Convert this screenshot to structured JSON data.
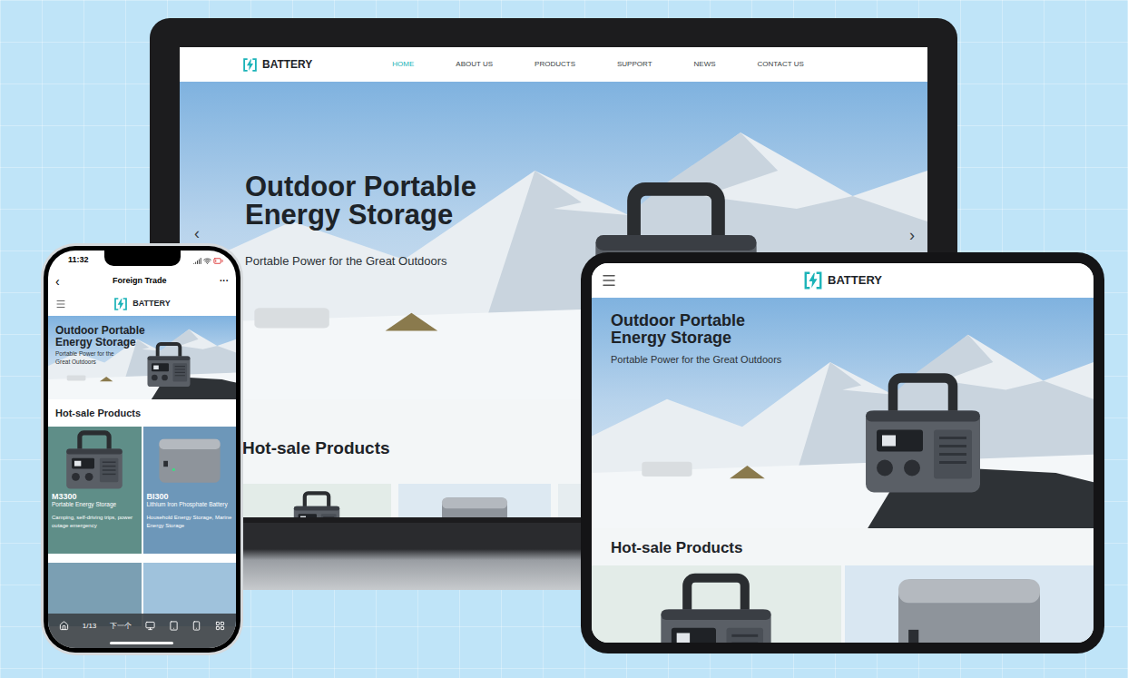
{
  "brand": "BATTERY",
  "laptop": {
    "nav": [
      {
        "label": "HOME",
        "selected": true
      },
      {
        "label": "ABOUT US",
        "selected": false
      },
      {
        "label": "PRODUCTS",
        "selected": false
      },
      {
        "label": "SUPPORT",
        "selected": false
      },
      {
        "label": "NEWS",
        "selected": false
      },
      {
        "label": "CONTACT US",
        "selected": false
      }
    ],
    "hero": {
      "title": "Outdoor Portable Energy Storage",
      "subtitle": "Portable Power for the Great Outdoors",
      "prev": "‹",
      "next": "›"
    },
    "section_title": "Hot-sale Products"
  },
  "tablet": {
    "hero": {
      "title": "Outdoor Portable Energy Storage",
      "subtitle": "Portable Power for the Great Outdoors"
    },
    "section_title": "Hot-sale Products"
  },
  "phone": {
    "status": {
      "time": "11:32"
    },
    "app_bar": {
      "back": "‹",
      "title": "Foreign Trade",
      "more": "···"
    },
    "hero": {
      "title": "Outdoor Portable Energy Storage",
      "subtitle": "Portable Power for the Great Outdoors"
    },
    "section_title": "Hot-sale Products",
    "products": [
      {
        "name": "M3300",
        "category": "Portable Energy Storage",
        "use": "Camping, self-driving trips, power outage emergency",
        "color": "#5f8e88"
      },
      {
        "name": "BI300",
        "category": "Lithium Iron Phosphate Battery",
        "use": "Household Energy Storage, Marine Energy Storage",
        "color": "#6d97b9"
      }
    ],
    "toolbar": {
      "page": "1/13",
      "next": "下一个"
    }
  }
}
